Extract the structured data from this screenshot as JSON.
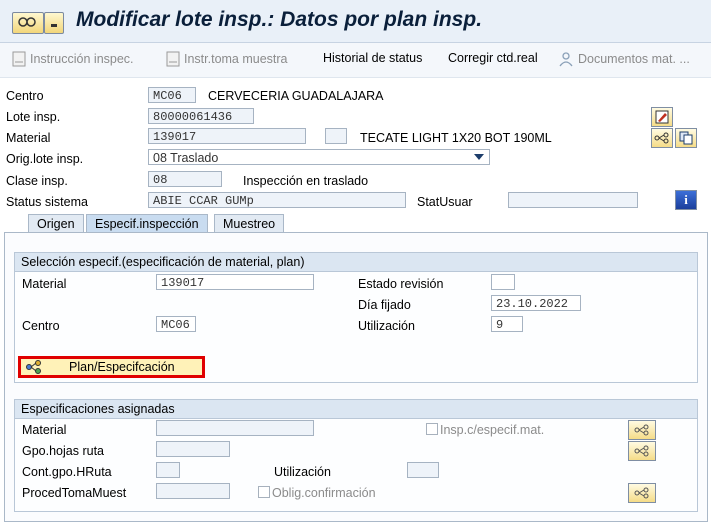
{
  "window": {
    "title": "Modificar lote insp.: Datos por plan insp."
  },
  "toolbar": {
    "instruccion": "Instrucción inspec.",
    "instr_toma": "Instr.toma muestra",
    "historial": "Historial de status",
    "corregir": "Corregir ctd.real",
    "documentos": "Documentos mat. ..."
  },
  "header": {
    "centro_label": "Centro",
    "centro_value": "MC06",
    "centro_desc": "CERVECERIA GUADALAJARA",
    "lote_label": "Lote insp.",
    "lote_value": "80000061436",
    "material_label": "Material",
    "material_value": "139017",
    "material_desc": "TECATE LIGHT  1X20 BOT 190ML",
    "orig_label": "Orig.lote insp.",
    "orig_value": "08 Traslado",
    "clase_label": "Clase insp.",
    "clase_value": "08",
    "clase_desc": "Inspección en traslado",
    "status_label": "Status sistema",
    "status_value": "ABIE CCAR GUMp",
    "statusuar_label": "StatUsuar",
    "statusuar_value": ""
  },
  "tabs": [
    "Origen",
    "Especif.inspección",
    "Muestreo"
  ],
  "seleccion": {
    "title": "Selección especif.(especificación de material, plan)",
    "material_label": "Material",
    "material_value": "139017",
    "centro_label": "Centro",
    "centro_value": "MC06",
    "estado_label": "Estado revisión",
    "estado_value": "",
    "dia_label": "Día fijado",
    "dia_value": "23.10.2022",
    "util_label": "Utilización",
    "util_value": "9",
    "plan_button": "Plan/Especifcación"
  },
  "asignadas": {
    "title": "Especificaciones asignadas",
    "material_label": "Material",
    "material_value": "",
    "gpo_label": "Gpo.hojas ruta",
    "gpo_value": "",
    "cont_label": "Cont.gpo.HRuta",
    "cont_value": "",
    "util_label": "Utilización",
    "util_value": "",
    "proced_label": "ProcedTomaMuest",
    "proced_value": "",
    "insp_check_label": "Insp.c/especif.mat.",
    "oblig_check_label": "Oblig.confirmación"
  },
  "colors": {
    "highlight_border": "#e00000",
    "title_bg": "#e9f0f8"
  },
  "icons": [
    "display-change-icon",
    "document-icon",
    "person-icon",
    "edit-icon",
    "hierarchy-icon",
    "info-icon"
  ]
}
